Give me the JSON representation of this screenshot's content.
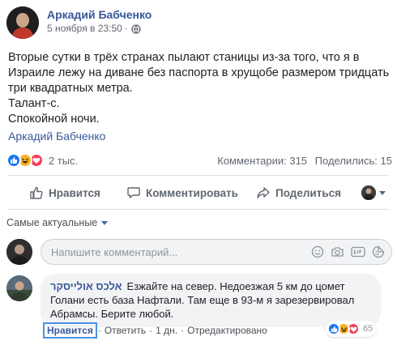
{
  "post": {
    "author": "Аркадий Бабченко",
    "timestamp": "5 ноября в 23:50",
    "separator": "·",
    "body_lines": [
      "Вторые сутки в трёх странах пылают станицы из-за того, что я в Израиле лежу на диване без паспорта в хрущобе размером тридцать три квадратных метра.",
      "Талант-с.",
      "Спокойной ночи."
    ],
    "shared_author": "Аркадий Бабченко"
  },
  "reactions": {
    "count_label": "2 тыс.",
    "icons": [
      "like-icon",
      "haha-icon",
      "love-icon"
    ],
    "comments_label": "Комментарии: 315",
    "shares_label": "Поделились: 15"
  },
  "actions": {
    "like": "Нравится",
    "comment": "Комментировать",
    "share": "Поделиться"
  },
  "sort": {
    "label": "Самые актуальные"
  },
  "composer": {
    "placeholder": "Напишите комментарий..."
  },
  "comment": {
    "author": "אלכס אולייסקר",
    "text": "Езжайте на север. Недоезжая 5 км до цомет Голани есть база Нафтали. Там еще в 93-м я зарезервировал Абрамсы. Берите любой.",
    "like_link": "Нравится",
    "reply_link": "Ответить",
    "age": "1 дн.",
    "edited": "Отредактировано",
    "sep": "·",
    "reaction_count": "65"
  },
  "colors": {
    "link": "#385898",
    "like_blue": "#1877f2",
    "haha_yellow": "#f7b125",
    "love_red": "#f33e58",
    "muted": "#606770"
  }
}
